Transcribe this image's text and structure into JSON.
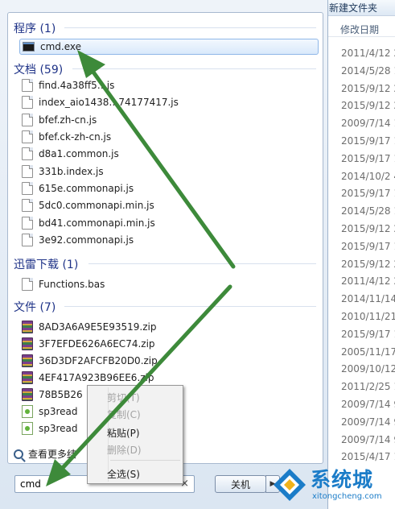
{
  "explorer": {
    "title": "新建文件夹",
    "date_column": "修改日期",
    "dates": [
      "2011/4/12 2",
      "2014/5/28 1",
      "2015/9/12 2",
      "2015/9/12 2",
      "2009/7/14 1",
      "2015/9/17 1",
      "2015/9/17 1",
      "2014/10/2 4",
      "2015/9/17 1",
      "2014/5/28 1",
      "2015/9/12 2",
      "2015/9/17 1",
      "2015/9/12 2",
      "2011/4/12 2",
      "2014/11/14",
      "2010/11/21",
      "2015/9/17 1",
      "2005/11/17",
      "2009/10/12",
      "2011/2/25 1",
      "2009/7/14 9",
      "2009/7/14 9",
      "2009/7/14 9",
      "2015/4/17 1"
    ]
  },
  "search": {
    "groups": [
      {
        "label": "程序 (1)",
        "items": [
          {
            "name": "cmd.exe",
            "icon": "cmd-icon",
            "selected": true
          }
        ]
      },
      {
        "label": "文档 (59)",
        "items": [
          {
            "name": "find.4a38ff5…js",
            "icon": "document-icon"
          },
          {
            "name": "index_aio1438…74177417.js",
            "icon": "document-icon"
          },
          {
            "name": "bfef.zh-cn.js",
            "icon": "document-icon"
          },
          {
            "name": "bfef.ck-zh-cn.js",
            "icon": "document-icon"
          },
          {
            "name": "d8a1.common.js",
            "icon": "document-icon"
          },
          {
            "name": "331b.index.js",
            "icon": "document-icon"
          },
          {
            "name": "615e.commonapi.js",
            "icon": "document-icon"
          },
          {
            "name": "5dc0.commonapi.min.js",
            "icon": "document-icon"
          },
          {
            "name": "bd41.commonapi.min.js",
            "icon": "document-icon"
          },
          {
            "name": "3e92.commonapi.js",
            "icon": "document-icon"
          }
        ]
      },
      {
        "label": "迅雷下载 (1)",
        "items": [
          {
            "name": "Functions.bas",
            "icon": "document-icon"
          }
        ]
      },
      {
        "label": "文件 (7)",
        "items": [
          {
            "name": "8AD3A6A9E5E93519.zip",
            "icon": "zip-icon"
          },
          {
            "name": "3F7EFDE626A6EC74.zip",
            "icon": "zip-icon"
          },
          {
            "name": "36D3DF2AFCFB20D0.zip",
            "icon": "zip-icon"
          },
          {
            "name": "4EF417A923B96EE6.zip",
            "icon": "zip-icon"
          },
          {
            "name": "78B5B26",
            "icon": "zip-icon"
          },
          {
            "name": "sp3read",
            "icon": "text-file-icon"
          },
          {
            "name": "sp3read",
            "icon": "text-file-icon"
          }
        ]
      }
    ],
    "see_more": "查看更多结",
    "query": "cmd",
    "clear": "×"
  },
  "shutdown": {
    "label": "关机",
    "arrow": "▶"
  },
  "context_menu": {
    "items": [
      {
        "label": "剪切(T)",
        "enabled": false
      },
      {
        "label": "复制(C)",
        "enabled": false
      },
      {
        "label": "粘贴(P)",
        "enabled": true
      },
      {
        "label": "删除(D)",
        "enabled": false
      },
      {
        "label": "全选(S)",
        "enabled": true
      }
    ]
  },
  "watermark": {
    "name": "系统城",
    "url": "xitongcheng.com"
  },
  "colors": {
    "accent": "#1e3287",
    "arrow": "#3d8a3a",
    "watermark": "#1b7cc8"
  }
}
